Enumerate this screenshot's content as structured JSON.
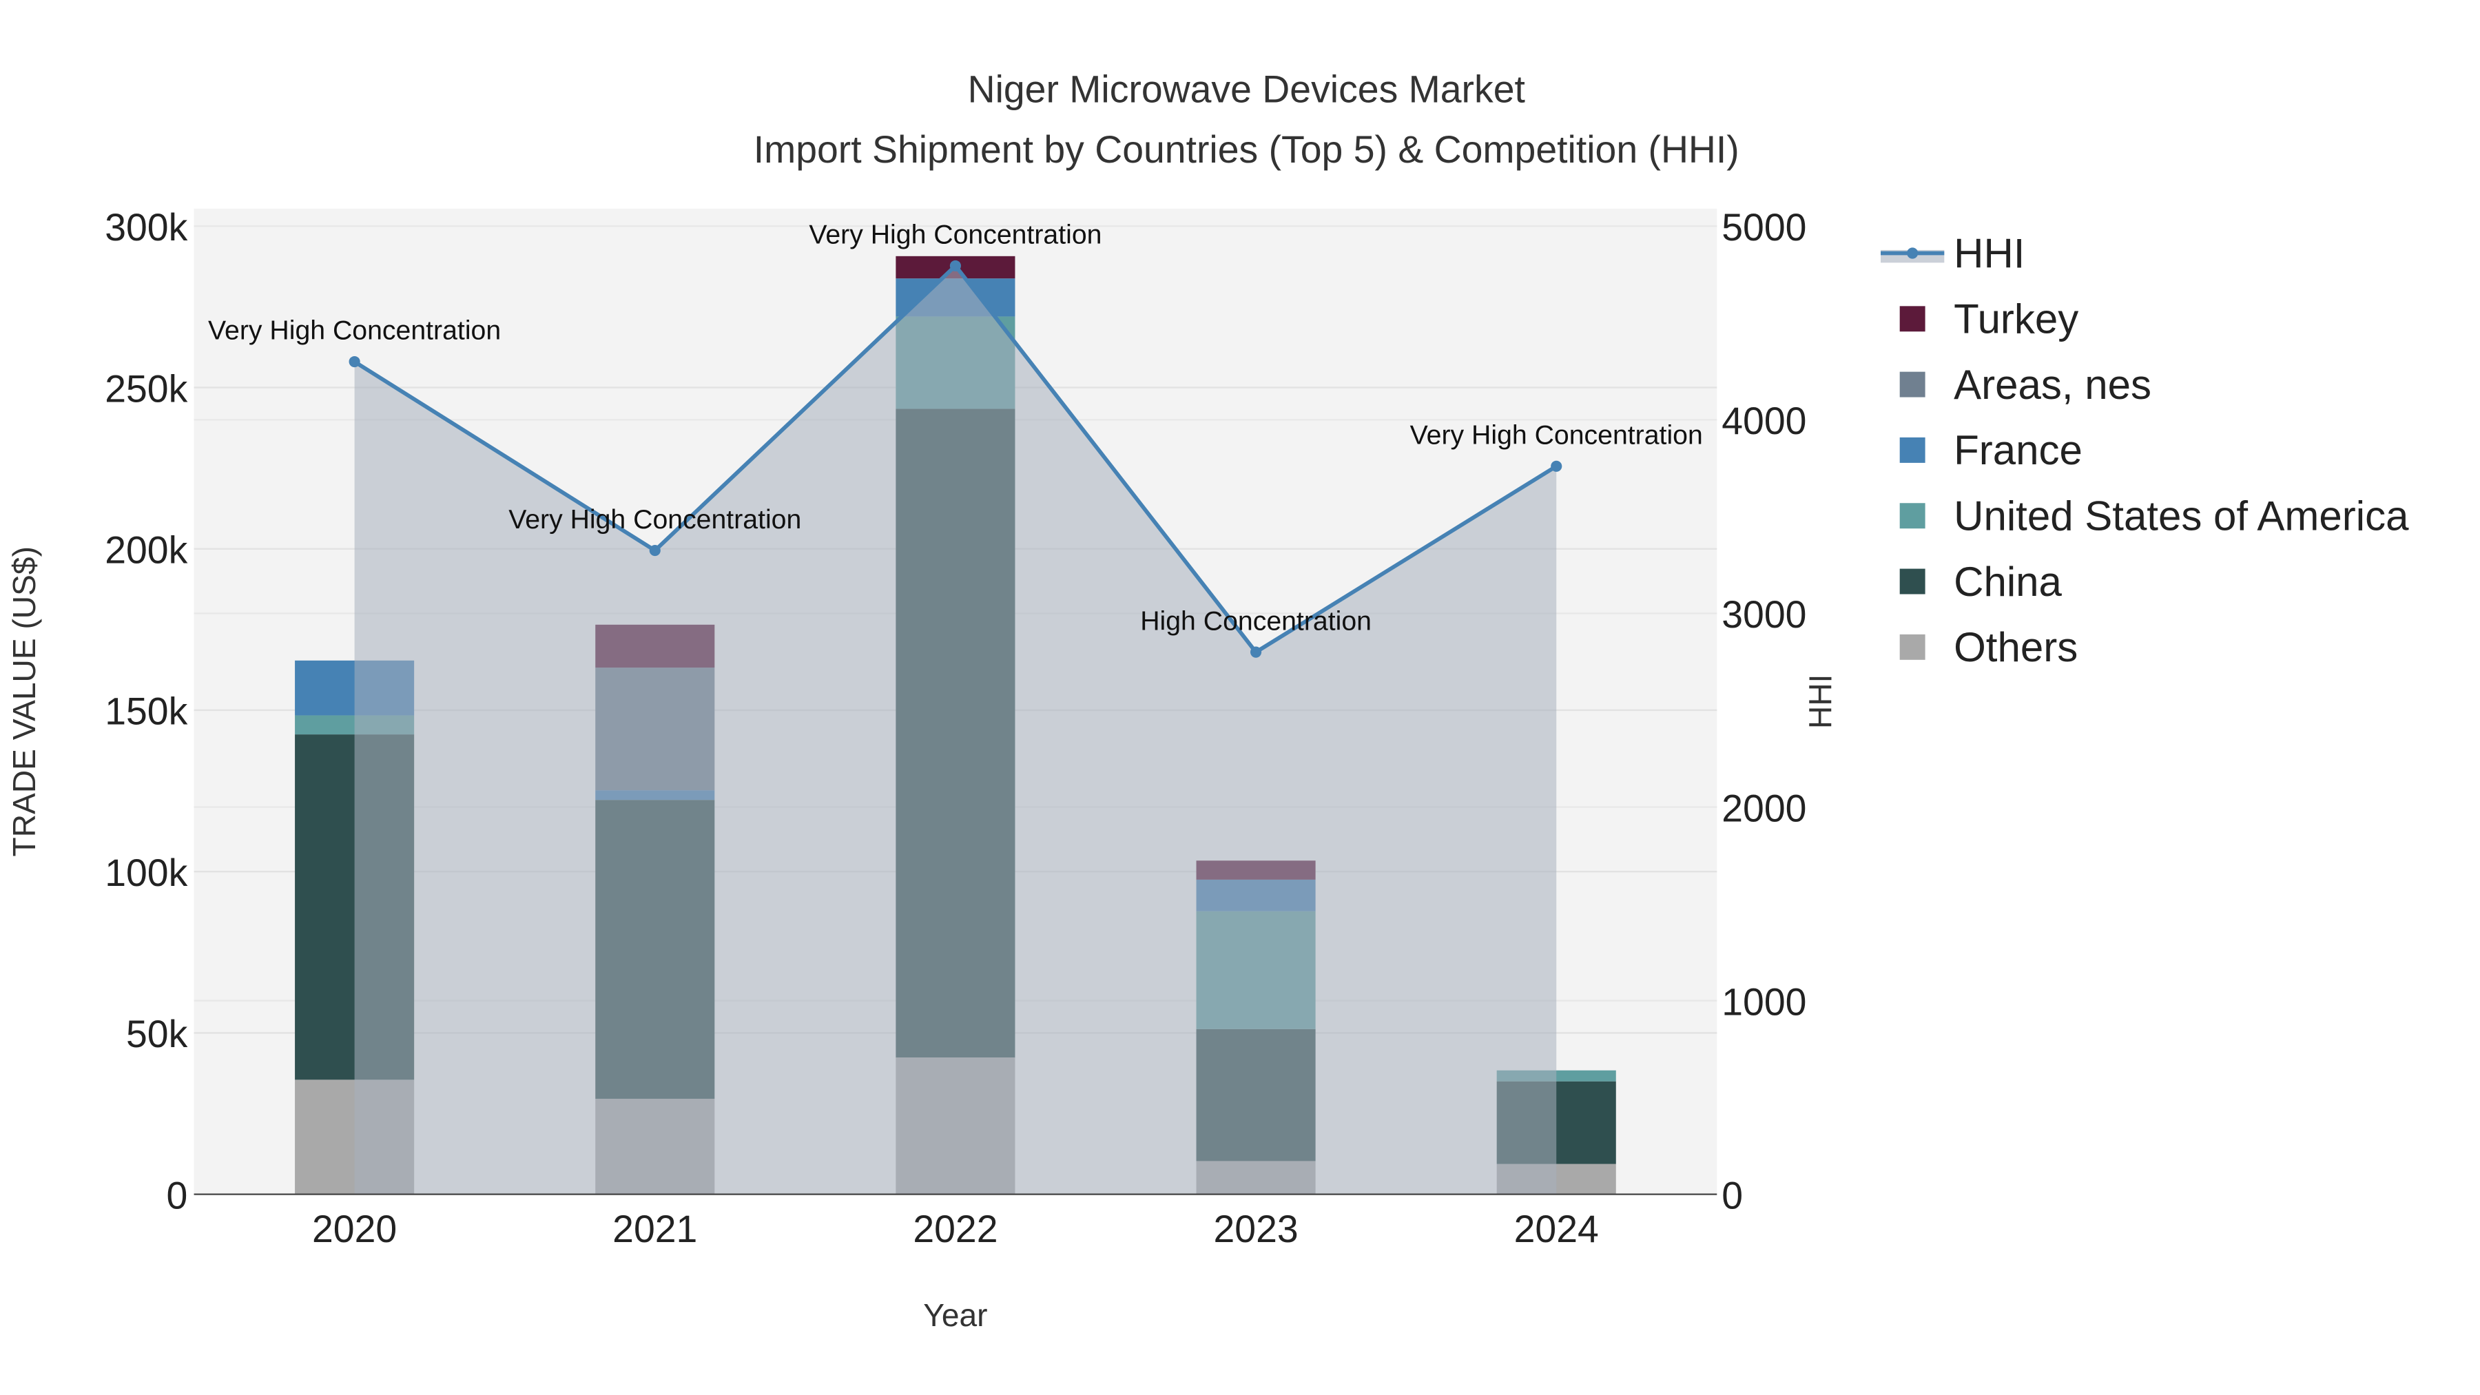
{
  "chart_data": {
    "type": "bar",
    "title": "Niger Microwave Devices Market",
    "subtitle": "Import Shipment by Countries (Top 5) & Competition (HHI)",
    "xlabel": "Year",
    "ylabel": "TRADE VALUE (US$)",
    "y2label": "HHI",
    "categories": [
      "2020",
      "2021",
      "2022",
      "2023",
      "2024"
    ],
    "ylim": [
      0,
      300000
    ],
    "y2lim": [
      0,
      5000
    ],
    "yticks": [
      {
        "v": 0,
        "label": "0"
      },
      {
        "v": 50000,
        "label": "50k"
      },
      {
        "v": 100000,
        "label": "100k"
      },
      {
        "v": 150000,
        "label": "150k"
      },
      {
        "v": 200000,
        "label": "200k"
      },
      {
        "v": 250000,
        "label": "250k"
      },
      {
        "v": 300000,
        "label": "300k"
      }
    ],
    "y2ticks": [
      {
        "v": 0,
        "label": "0"
      },
      {
        "v": 1000,
        "label": "1000"
      },
      {
        "v": 2000,
        "label": "2000"
      },
      {
        "v": 3000,
        "label": "3000"
      },
      {
        "v": 4000,
        "label": "4000"
      },
      {
        "v": 5000,
        "label": "5000"
      }
    ],
    "stacked": true,
    "series": [
      {
        "name": "Others",
        "color": "#a9a9a9",
        "values": [
          35500,
          29600,
          42400,
          10300,
          9400
        ]
      },
      {
        "name": "China",
        "color": "#2f4f4f",
        "values": [
          107000,
          92600,
          201000,
          40900,
          25600
        ]
      },
      {
        "name": "United States of America",
        "color": "#5f9ea0",
        "values": [
          5900,
          0,
          28600,
          36500,
          3400
        ]
      },
      {
        "name": "France",
        "color": "#4682b4",
        "values": [
          17000,
          3000,
          11800,
          9800,
          0
        ]
      },
      {
        "name": "Areas, nes",
        "color": "#708090",
        "values": [
          0,
          38000,
          0,
          0,
          0
        ]
      },
      {
        "name": "Turkey",
        "color": "#5c1a3a",
        "values": [
          0,
          13300,
          6900,
          5900,
          0
        ]
      }
    ],
    "hhi": {
      "name": "HHI",
      "color": "#4682b4",
      "values": [
        4300,
        3325,
        4795,
        2800,
        3760
      ],
      "annotations": [
        "Very High Concentration",
        "Very High Concentration",
        "Very High Concentration",
        "High Concentration",
        "Very High Concentration"
      ]
    },
    "legend": {
      "placement": "right",
      "order": [
        "HHI",
        "Turkey",
        "Areas, nes",
        "France",
        "United States of America",
        "China",
        "Others"
      ]
    }
  }
}
